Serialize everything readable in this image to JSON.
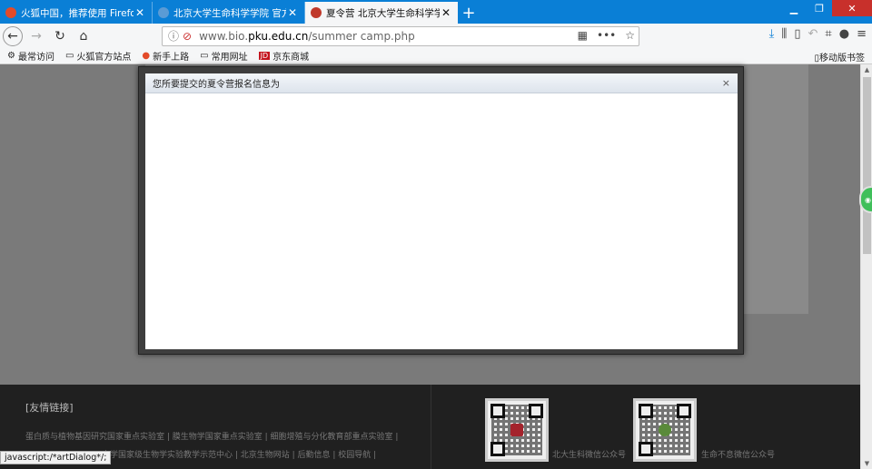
{
  "tabs": [
    {
      "title": "火狐中国，推荐使用 Firefox 火",
      "icon": "firefox-icon",
      "color": "#e34b2a"
    },
    {
      "title": "北京大学生命科学学院 官方网站",
      "icon": "pku-icon",
      "color": "#5a9bd5"
    },
    {
      "title": "夏令营 北京大学生命科学学院",
      "icon": "pku-icon",
      "color": "#c0392b"
    }
  ],
  "new_tab": "+",
  "url": {
    "prefix": "www.bio.",
    "domain": "pku.edu.cn",
    "path": "/summer camp.php"
  },
  "bookmarks": [
    {
      "label": "最常访问",
      "icon": "gear-icon"
    },
    {
      "label": "火狐官方站点",
      "icon": "folder-icon"
    },
    {
      "label": "新手上路",
      "icon": "firefox-icon"
    },
    {
      "label": "常用网址",
      "icon": "folder-icon"
    },
    {
      "label": "京东商城",
      "icon": "jd-icon"
    }
  ],
  "mobile_bookmarks": "移动版书签",
  "dialog": {
    "title": "您所要提交的夏令营报名信息为",
    "close": "×"
  },
  "footer": {
    "title": "[友情链接]",
    "links_row1": "蛋白质与植物基因研究国家重点实验室 | 膜生物学国家重点实验室 | 细胞增殖与分化教育部重点实验室 |",
    "links_row2": "大学国家级生物学实验教学示范中心 | 北京生物网站 | 后勤信息 | 校园导航 |",
    "qr_caption_1": "北大生科微信公众号",
    "qr_caption_2": "生命不息微信公众号"
  },
  "statusbar": "javascript:/*artDialog*/;"
}
